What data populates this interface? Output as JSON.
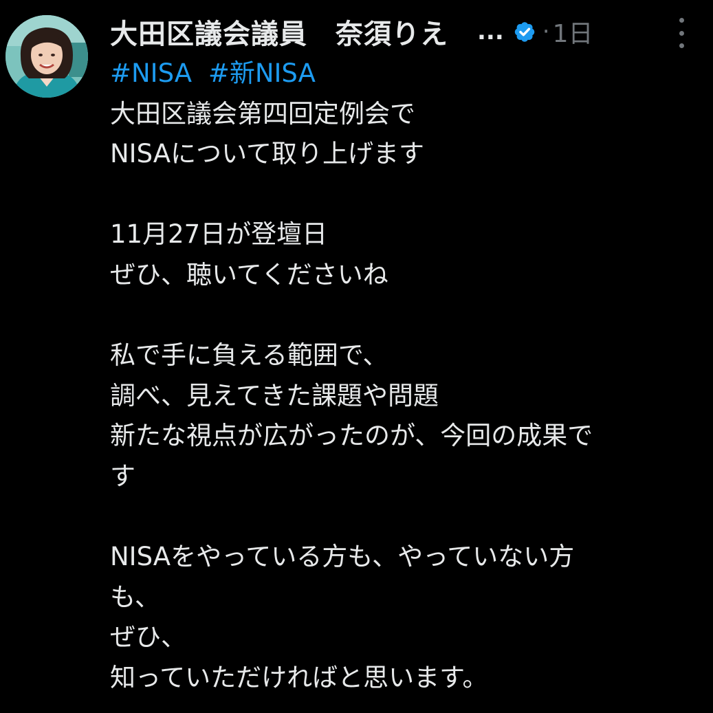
{
  "post": {
    "author_name": "大田区議会議員　奈須りえ",
    "ellipsis": "...",
    "verified_icon": "verified-badge-icon",
    "dot": "·",
    "time": "1日",
    "more_icon": "more-vertical-icon",
    "hashtags": [
      "#NISA",
      "#新NISA"
    ],
    "lines": [
      "大田区議会第四回定例会で",
      "NISAについて取り上げます",
      "",
      "11月27日が登壇日",
      "ぜひ、聴いてくださいね",
      "",
      "私で手に負える範囲で、",
      "調べ、見えてきた課題や問題",
      "新たな視点が広がったのが、今回の成果で",
      "す",
      "",
      "NISAをやっている方も、やっていない方",
      "も、",
      "ぜひ、",
      "知っていただければと思います。"
    ]
  },
  "colors": {
    "background": "#000000",
    "text": "#e7e9ea",
    "muted": "#71767b",
    "link": "#1d9bf0",
    "verified": "#1d9bf0"
  }
}
